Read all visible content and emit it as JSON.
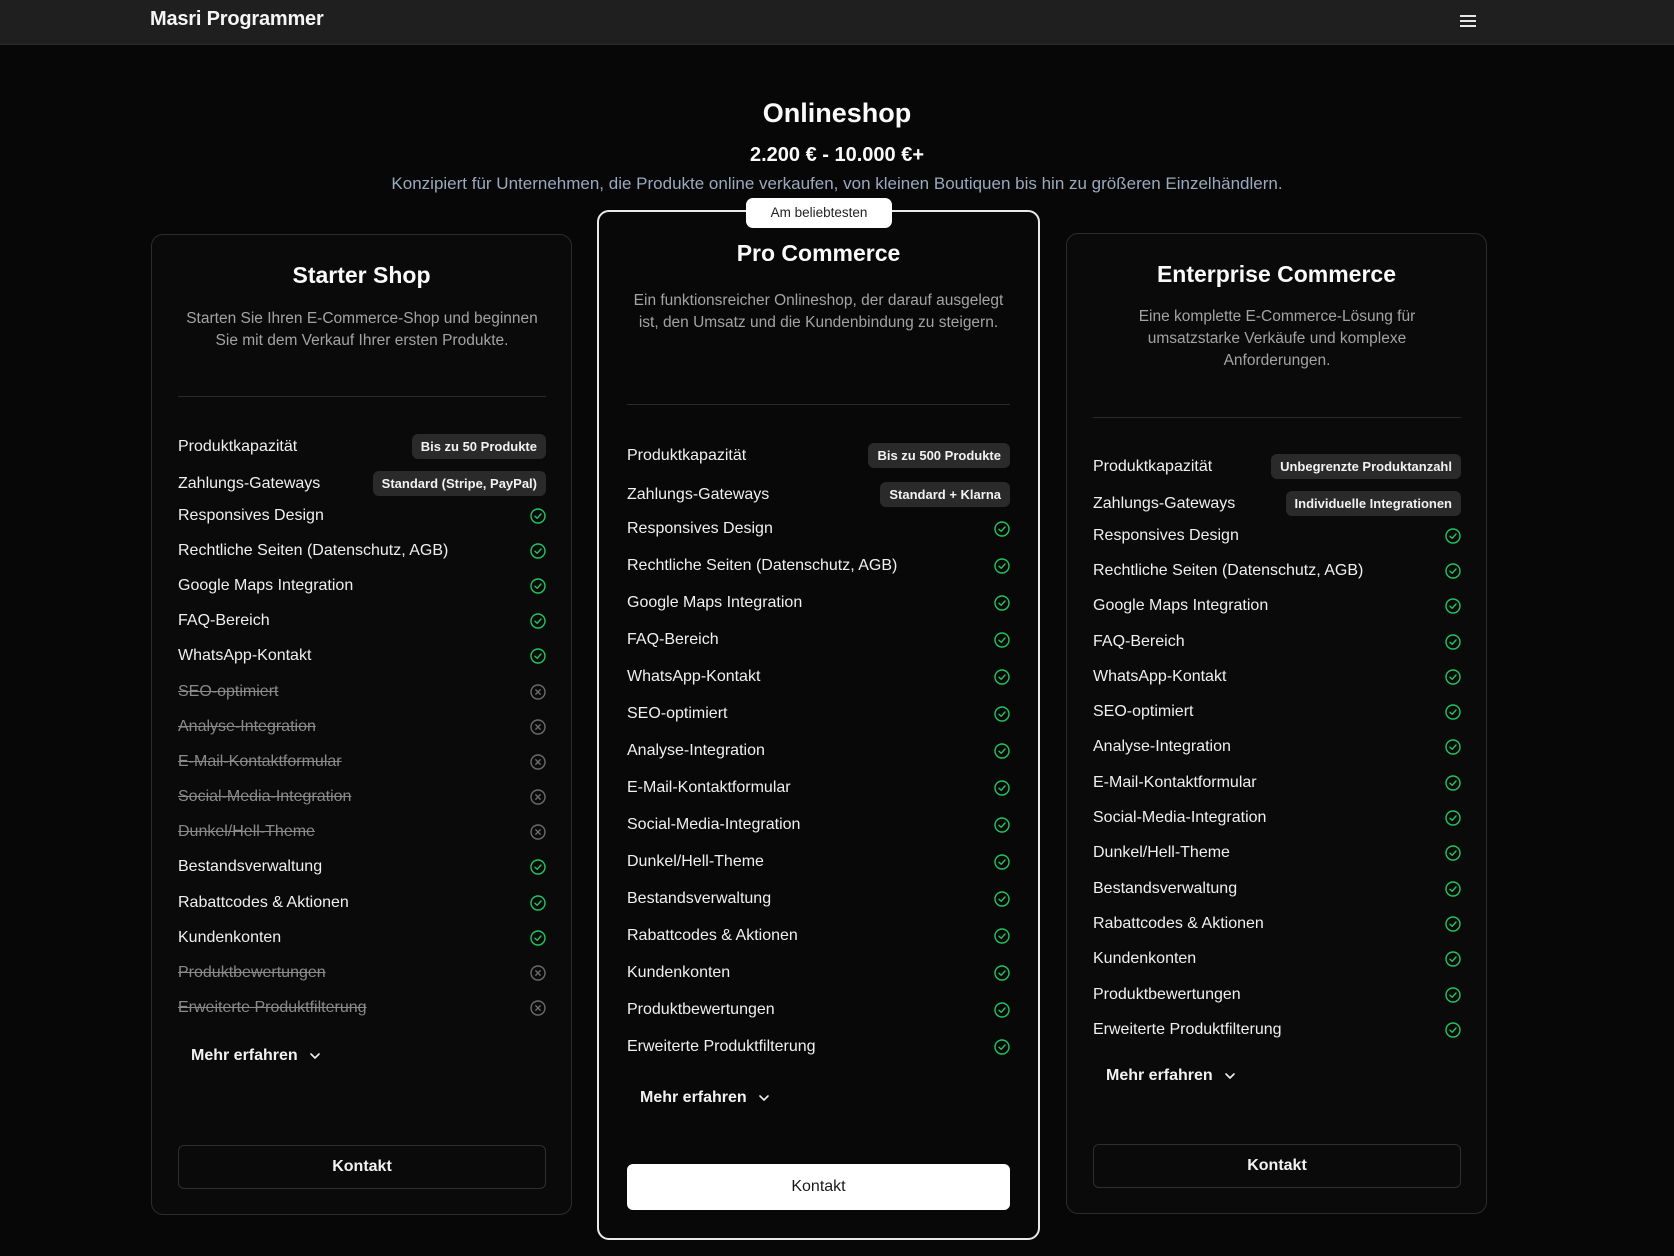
{
  "nav": {
    "brand": "Masri Programmer",
    "menu_icon": "hamburger-menu-icon"
  },
  "hero": {
    "title": "Onlineshop",
    "price": "2.200 € - 10.000 €+",
    "description": "Konzipiert für Unternehmen, die Produkte online verkaufen, von kleinen Boutiquen bis hin zu größeren Einzelhändlern."
  },
  "colors": {
    "accent_green": "#22c55e",
    "muted_gray": "#6b6b6b",
    "background": "#070707"
  },
  "plans": [
    {
      "name": "Starter Shop",
      "description": "Starten Sie Ihren E-Commerce-Shop und beginnen Sie mit dem Verkauf Ihrer ersten Produkte.",
      "badge": "",
      "specs": [
        {
          "label": "Produktkapazität",
          "value": "Bis zu 50 Produkte"
        },
        {
          "label": "Zahlungs-Gateways",
          "value": "Standard (Stripe, PayPal)"
        }
      ],
      "features": [
        {
          "label": "Responsives Design",
          "included": true
        },
        {
          "label": "Rechtliche Seiten (Datenschutz, AGB)",
          "included": true
        },
        {
          "label": "Google Maps Integration",
          "included": true
        },
        {
          "label": "FAQ-Bereich",
          "included": true
        },
        {
          "label": "WhatsApp-Kontakt",
          "included": true
        },
        {
          "label": "SEO-optimiert",
          "included": false
        },
        {
          "label": "Analyse-Integration",
          "included": false
        },
        {
          "label": "E-Mail-Kontaktformular",
          "included": false
        },
        {
          "label": "Social-Media-Integration",
          "included": false
        },
        {
          "label": "Dunkel/Hell-Theme",
          "included": false
        },
        {
          "label": "Bestandsverwaltung",
          "included": true
        },
        {
          "label": "Rabattcodes & Aktionen",
          "included": true
        },
        {
          "label": "Kundenkonten",
          "included": true
        },
        {
          "label": "Produktbewertungen",
          "included": false
        },
        {
          "label": "Erweiterte Produktfilterung",
          "included": false
        }
      ],
      "more_label": "Mehr erfahren",
      "cta_label": "Kontakt"
    },
    {
      "name": "Pro Commerce",
      "description": "Ein funktionsreicher Onlineshop, der darauf ausgelegt ist, den Umsatz und die Kundenbindung zu steigern.",
      "badge": "Am beliebtesten",
      "specs": [
        {
          "label": "Produktkapazität",
          "value": "Bis zu 500 Produkte"
        },
        {
          "label": "Zahlungs-Gateways",
          "value": "Standard + Klarna"
        }
      ],
      "features": [
        {
          "label": "Responsives Design",
          "included": true
        },
        {
          "label": "Rechtliche Seiten (Datenschutz, AGB)",
          "included": true
        },
        {
          "label": "Google Maps Integration",
          "included": true
        },
        {
          "label": "FAQ-Bereich",
          "included": true
        },
        {
          "label": "WhatsApp-Kontakt",
          "included": true
        },
        {
          "label": "SEO-optimiert",
          "included": true
        },
        {
          "label": "Analyse-Integration",
          "included": true
        },
        {
          "label": "E-Mail-Kontaktformular",
          "included": true
        },
        {
          "label": "Social-Media-Integration",
          "included": true
        },
        {
          "label": "Dunkel/Hell-Theme",
          "included": true
        },
        {
          "label": "Bestandsverwaltung",
          "included": true
        },
        {
          "label": "Rabattcodes & Aktionen",
          "included": true
        },
        {
          "label": "Kundenkonten",
          "included": true
        },
        {
          "label": "Produktbewertungen",
          "included": true
        },
        {
          "label": "Erweiterte Produktfilterung",
          "included": true
        }
      ],
      "more_label": "Mehr erfahren",
      "cta_label": "Kontakt"
    },
    {
      "name": "Enterprise Commerce",
      "description": "Eine komplette E-Commerce-Lösung für umsatzstarke Verkäufe und komplexe Anforderungen.",
      "badge": "",
      "specs": [
        {
          "label": "Produktkapazität",
          "value": "Unbegrenzte Produktanzahl"
        },
        {
          "label": "Zahlungs-Gateways",
          "value": "Individuelle Integrationen"
        }
      ],
      "features": [
        {
          "label": "Responsives Design",
          "included": true
        },
        {
          "label": "Rechtliche Seiten (Datenschutz, AGB)",
          "included": true
        },
        {
          "label": "Google Maps Integration",
          "included": true
        },
        {
          "label": "FAQ-Bereich",
          "included": true
        },
        {
          "label": "WhatsApp-Kontakt",
          "included": true
        },
        {
          "label": "SEO-optimiert",
          "included": true
        },
        {
          "label": "Analyse-Integration",
          "included": true
        },
        {
          "label": "E-Mail-Kontaktformular",
          "included": true
        },
        {
          "label": "Social-Media-Integration",
          "included": true
        },
        {
          "label": "Dunkel/Hell-Theme",
          "included": true
        },
        {
          "label": "Bestandsverwaltung",
          "included": true
        },
        {
          "label": "Rabattcodes & Aktionen",
          "included": true
        },
        {
          "label": "Kundenkonten",
          "included": true
        },
        {
          "label": "Produktbewertungen",
          "included": true
        },
        {
          "label": "Erweiterte Produktfilterung",
          "included": true
        }
      ],
      "more_label": "Mehr erfahren",
      "cta_label": "Kontakt"
    }
  ]
}
